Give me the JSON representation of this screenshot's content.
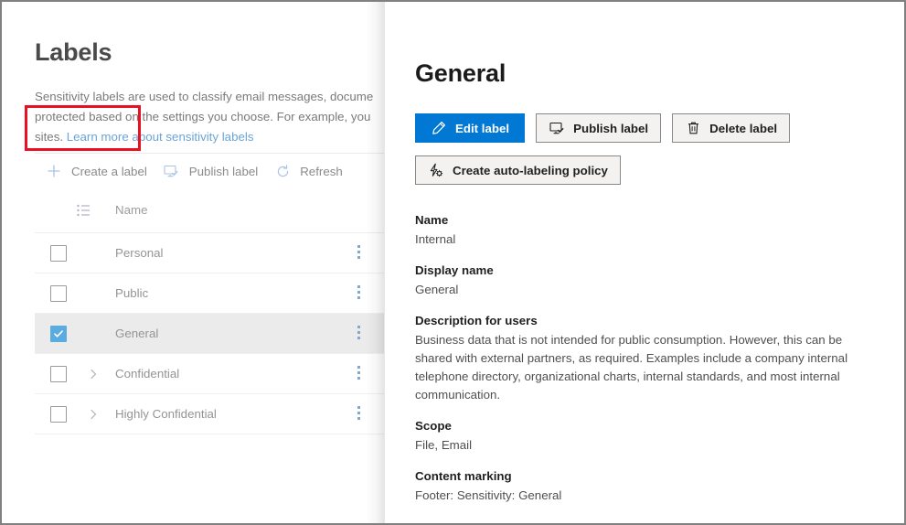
{
  "left_pane": {
    "title": "Labels",
    "description_line1": "Sensitivity labels are used to classify email messages, docume",
    "description_line2": "protected based on the settings you choose. For example, you",
    "description_line3_prefix": "sites. ",
    "description_link": "Learn more about sensitivity labels",
    "toolbar": [
      {
        "label": "Create a label",
        "icon": "plus-icon"
      },
      {
        "label": "Publish label",
        "icon": "monitor-check-icon"
      },
      {
        "label": "Refresh",
        "icon": "refresh-icon"
      }
    ],
    "table": {
      "header_icon": "list-view-icon",
      "columns": [
        "Name"
      ],
      "rows": [
        {
          "name": "Personal",
          "checked": false,
          "expandable": false,
          "selected": false
        },
        {
          "name": "Public",
          "checked": false,
          "expandable": false,
          "selected": false
        },
        {
          "name": "General",
          "checked": true,
          "expandable": false,
          "selected": true
        },
        {
          "name": "Confidential",
          "checked": false,
          "expandable": true,
          "selected": false
        },
        {
          "name": "Highly Confidential",
          "checked": false,
          "expandable": true,
          "selected": false
        }
      ],
      "row_menu_icon": "more-vertical-icon"
    }
  },
  "flyout": {
    "title": "General",
    "buttons": [
      {
        "label": "Edit label",
        "icon": "pencil-icon",
        "primary": true,
        "highlighted": true
      },
      {
        "label": "Publish label",
        "icon": "monitor-check-icon",
        "primary": false,
        "highlighted": false
      },
      {
        "label": "Delete label",
        "icon": "trash-icon",
        "primary": false,
        "highlighted": false
      },
      {
        "label": "Create auto-labeling policy",
        "icon": "lightning-gear-icon",
        "primary": false,
        "highlighted": false
      }
    ],
    "fields": [
      {
        "label": "Name",
        "value": "Internal"
      },
      {
        "label": "Display name",
        "value": "General"
      },
      {
        "label": "Description for users",
        "value": "Business data that is not intended for public consumption. However, this can be shared with external partners, as required. Examples include a company internal telephone directory, organizational charts, internal standards, and most internal communication."
      },
      {
        "label": "Scope",
        "value": "File, Email"
      },
      {
        "label": "Content marking",
        "value": "Footer: Sensitivity: General"
      }
    ]
  },
  "colors": {
    "primary_blue": "#0078d4",
    "highlight_red": "#e81123",
    "checkbox_blue": "#5aabe0",
    "link_blue": "#6ba4d8",
    "selected_row_bg": "#ebebeb"
  }
}
